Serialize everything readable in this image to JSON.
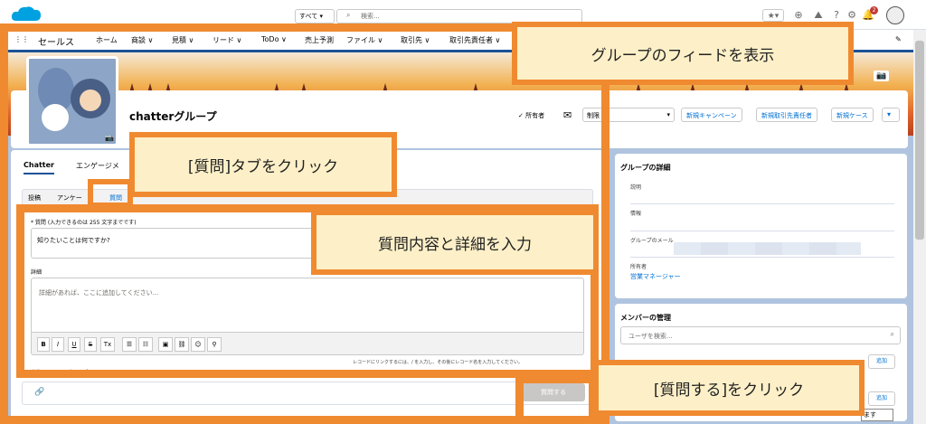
{
  "topbar": {
    "search_scope": "すべて ▾",
    "search_placeholder": "検索...",
    "notification_count": "2"
  },
  "nav": {
    "app_name": "セールス",
    "items": [
      "ホーム",
      "商談 ∨",
      "見積 ∨",
      "リード ∨",
      "ToDo ∨",
      "売上予測",
      "ファイル ∨",
      "取引先 ∨",
      "取引先責任者 ∨"
    ]
  },
  "group": {
    "title": "chatterグループ",
    "owner_label": "所有者",
    "limit_select": "制限",
    "actions": [
      "新規キャンペーン",
      "新規取引先責任者",
      "新規ケース"
    ]
  },
  "feed": {
    "tabs": [
      "Chatter",
      "エンゲージメ"
    ],
    "publisher_tabs": [
      "投稿",
      "アンケー",
      "質問"
    ],
    "question_label": "* 質問 (入力できるのは 255 文字までです)",
    "question_value": "知りたいことは何ですか?",
    "detail_label": "詳細",
    "detail_placeholder": "詳細があれば、ここに追加してください...",
    "toolbar": [
      "B",
      "I",
      "U",
      "S",
      "Tx",
      "☰",
      "☷",
      "▣",
      "⛓",
      "☺",
      "⚲"
    ],
    "rte_hint": "レコードにリンクするには、/ を入力し、その後にレコード名を入力してください。",
    "to_line": "宛先 : chatterグループ",
    "ask_button": "質問する"
  },
  "details": {
    "title": "グループの詳細",
    "labels": [
      "説明",
      "情報",
      "グループのメール",
      "所有者"
    ],
    "owner_value": "営業マネージャー"
  },
  "members": {
    "title": "メンバーの管理",
    "search_placeholder": "ユーザを検索...",
    "add_label": "追加",
    "tooltip": "ます"
  },
  "callouts": {
    "view_feed": "グループのフィードを表示",
    "click_tab": "[質問]タブをクリック",
    "enter_question": "質問内容と詳細を入力",
    "click_ask": "[質問する]をクリック"
  },
  "colors": {
    "overlay": "#f08a30",
    "callout_bg": "#fdf0c8",
    "brand": "#1b5297",
    "link": "#0070d2"
  }
}
